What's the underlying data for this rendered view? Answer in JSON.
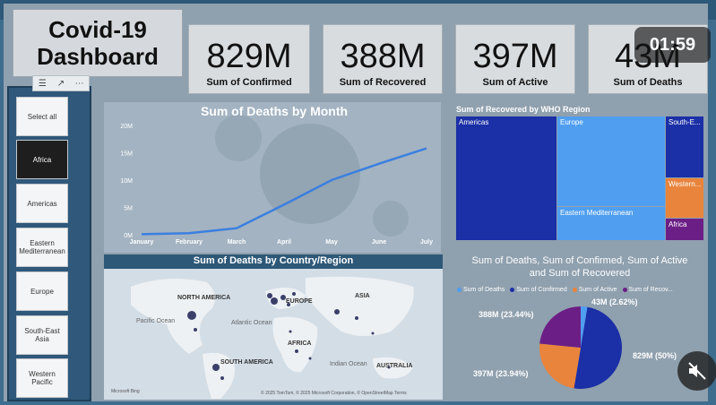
{
  "dashboard": {
    "title": "Covid-19\nDashboard"
  },
  "kpis": [
    {
      "value": "829M",
      "label": "Sum of Confirmed"
    },
    {
      "value": "388M",
      "label": "Sum of Recovered"
    },
    {
      "value": "397M",
      "label": "Sum of Active"
    },
    {
      "value": "43M",
      "label": "Sum of Deaths"
    }
  ],
  "slicer": {
    "items": [
      "Select all",
      "Africa",
      "Americas",
      "Eastern Mediterranean",
      "Europe",
      "South-East Asia",
      "Western Pacific"
    ],
    "selected": "Africa"
  },
  "line_chart": {
    "title": "Sum of Deaths by Month"
  },
  "map": {
    "title": "Sum of Deaths by Country/Region",
    "labels": {
      "north_america": "NORTH AMERICA",
      "europe": "EUROPE",
      "asia": "ASIA",
      "pacific": "Pacific\nOcean",
      "atlantic": "Atlantic\nOcean",
      "africa": "AFRICA",
      "south_america": "SOUTH AMERICA",
      "indian": "Indian\nOcean",
      "australia": "AUSTRALIA"
    },
    "credit": "© 2025 TomTom, © 2025 Microsoft Corporation, © OpenStreetMap  Terms",
    "brand": "Microsoft Bing"
  },
  "treemap": {
    "title": "Sum of Recovered by WHO Region",
    "cells": [
      {
        "label": "Americas",
        "color": "#1b2fa6"
      },
      {
        "label": "Europe",
        "color": "#4f9ef0"
      },
      {
        "label": "Eastern Mediterranean",
        "color": "#4f9ef0"
      },
      {
        "label": "South-E...",
        "color": "#1b2fa6"
      },
      {
        "label": "Western...",
        "color": "#e9843c"
      },
      {
        "label": "Africa",
        "color": "#6b1f86"
      }
    ]
  },
  "pie": {
    "title": "Sum of Deaths, Sum of Confirmed, Sum of Active\nand Sum of Recovered",
    "legend": [
      {
        "name": "Sum of Deaths",
        "color": "#4f9ef0"
      },
      {
        "name": "Sum of Confirmed",
        "color": "#1b2fa6"
      },
      {
        "name": "Sum of Active",
        "color": "#e9843c"
      },
      {
        "name": "Sum of Recov...",
        "color": "#6b1f86"
      }
    ],
    "labels": {
      "deaths": "43M (2.62%)",
      "confirmed": "829M (50%)",
      "active": "397M (23.94%)",
      "recovered": "388M (23.44%)"
    }
  },
  "video": {
    "time": "01:59"
  },
  "chart_data": [
    {
      "type": "line",
      "title": "Sum of Deaths by Month",
      "categories": [
        "January",
        "February",
        "March",
        "April",
        "May",
        "June",
        "July"
      ],
      "y_ticks": [
        "0M",
        "5M",
        "10M",
        "15M",
        "20M"
      ],
      "ylim": [
        0,
        20
      ],
      "series": [
        {
          "values": [
            0.1,
            0.3,
            1.2,
            5.5,
            10.0,
            13.0,
            15.8
          ],
          "color": "#3b7fe0"
        }
      ]
    },
    {
      "type": "pie",
      "title": "Sum of Deaths, Sum of Confirmed, Sum of Active and Sum of Recovered",
      "slices": [
        {
          "name": "Sum of Deaths",
          "value": 2.62,
          "color": "#4f9ef0"
        },
        {
          "name": "Sum of Confirmed",
          "value": 50,
          "color": "#1b2fa6"
        },
        {
          "name": "Sum of Active",
          "value": 23.94,
          "color": "#e9843c"
        },
        {
          "name": "Sum of Recovered",
          "value": 23.44,
          "color": "#6b1f86"
        }
      ]
    }
  ]
}
